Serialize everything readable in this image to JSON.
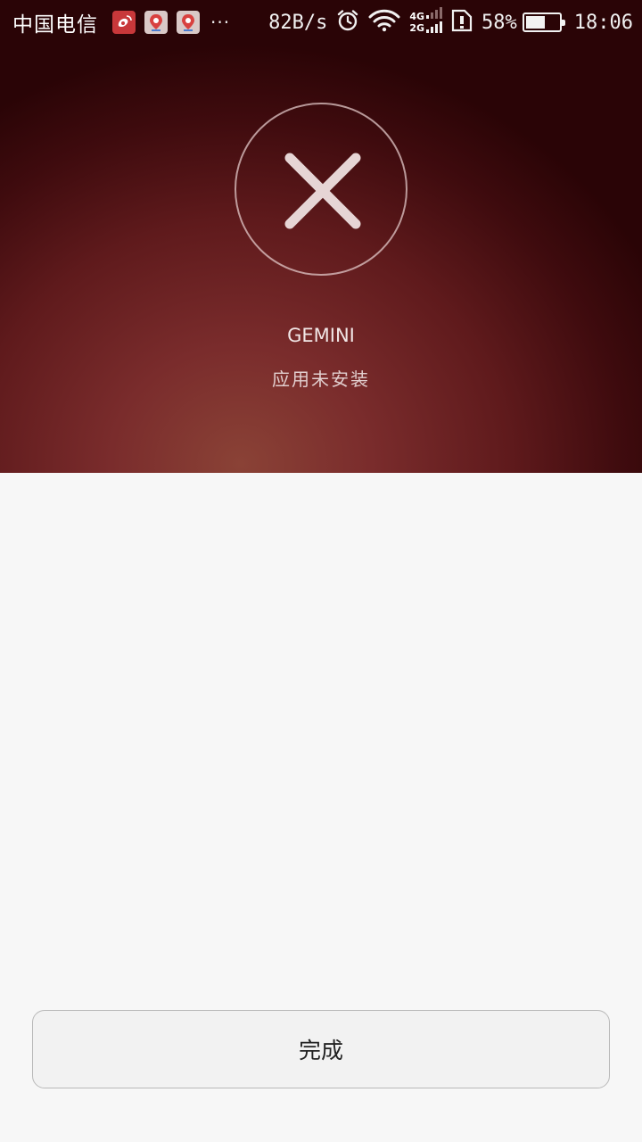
{
  "status_bar": {
    "carrier": "中国电信",
    "notifications": [
      {
        "icon": "weibo-app-icon",
        "color": "#c8383a"
      },
      {
        "icon": "baidu-maps-app-icon",
        "color": "#d9c9c7"
      },
      {
        "icon": "baidu-maps-app-icon",
        "color": "#d9c9c7"
      }
    ],
    "more": "···",
    "net_speed": "82B/s",
    "network_top": "4G",
    "network_bottom": "2G",
    "battery_percent": "58%",
    "battery_level": 0.58,
    "time": "18:06"
  },
  "result": {
    "icon": "close-icon",
    "app_name": "GEMINI",
    "status": "应用未安装"
  },
  "footer": {
    "done_label": "完成"
  },
  "colors": {
    "hero_dark": "#2a0406",
    "hero_light": "#8a4236",
    "background": "#f7f7f7",
    "button_bg": "#f2f2f2"
  }
}
